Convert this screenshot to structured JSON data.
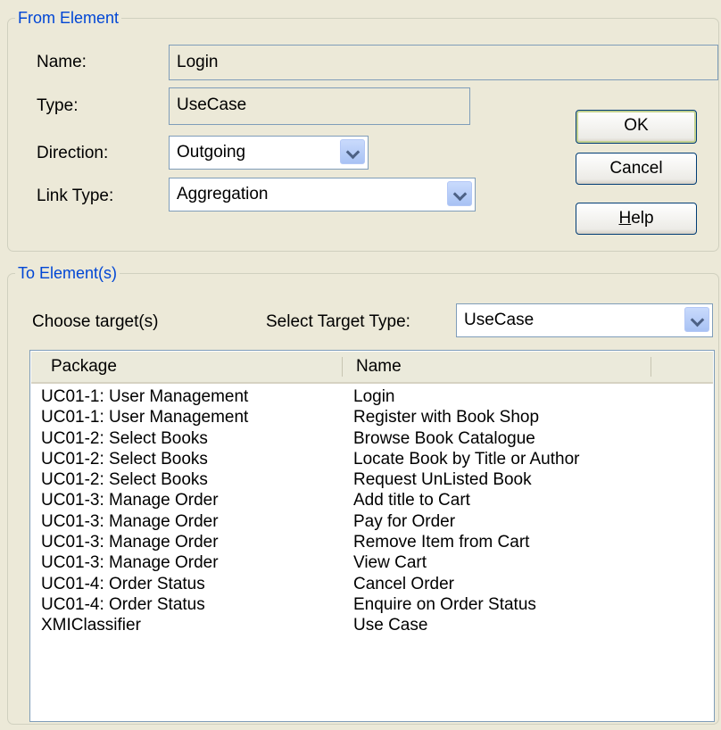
{
  "from_group": {
    "title": "From Element",
    "name_label": "Name:",
    "name_value": "Login",
    "type_label": "Type:",
    "type_value": "UseCase",
    "direction_label": "Direction:",
    "direction_value": "Outgoing",
    "link_type_label": "Link Type:",
    "link_type_value": "Aggregation"
  },
  "buttons": {
    "ok": "OK",
    "cancel": "Cancel",
    "help_mnemonic": "H",
    "help_rest": "elp"
  },
  "to_group": {
    "title": "To Element(s)",
    "choose_label": "Choose target(s)",
    "select_type_label": "Select Target Type:",
    "select_type_value": "UseCase"
  },
  "list": {
    "columns": [
      "Package",
      "Name"
    ],
    "rows": [
      [
        "UC01-1: User Management",
        "Login"
      ],
      [
        "UC01-1: User Management",
        "Register with Book Shop"
      ],
      [
        "UC01-2: Select Books",
        "Browse Book Catalogue"
      ],
      [
        "UC01-2: Select Books",
        "Locate Book by Title or Author"
      ],
      [
        "UC01-2: Select Books",
        "Request UnListed Book"
      ],
      [
        "UC01-3: Manage Order",
        "Add title to Cart"
      ],
      [
        "UC01-3: Manage Order",
        "Pay for Order"
      ],
      [
        "UC01-3: Manage Order",
        "Remove Item from Cart"
      ],
      [
        "UC01-3: Manage Order",
        "View Cart"
      ],
      [
        "UC01-4: Order Status",
        "Cancel Order"
      ],
      [
        "UC01-4: Order Status",
        "Enquire on Order Status"
      ],
      [
        "XMIClassifier",
        "Use Case"
      ]
    ]
  }
}
